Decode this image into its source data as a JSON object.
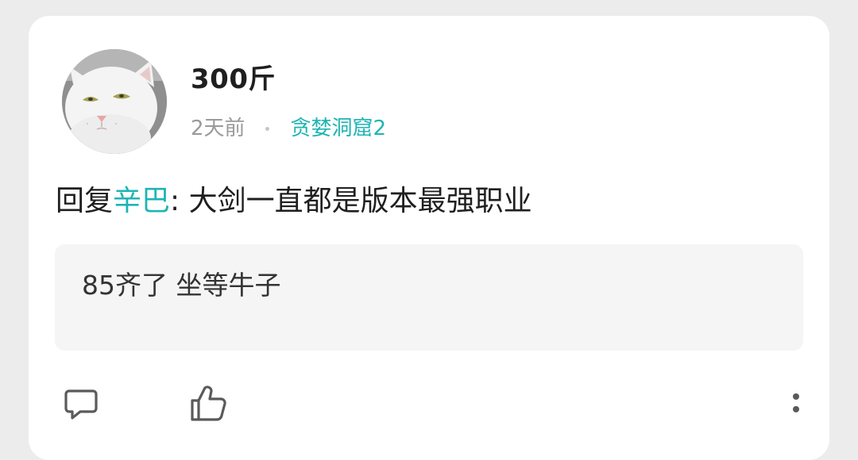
{
  "post": {
    "author": {
      "name": "300斤",
      "avatar_icon": "white-cat-avatar"
    },
    "time_ago": "2天前",
    "community": "贪婪洞窟2",
    "reply_prefix": "回复",
    "reply_target": "辛巴",
    "reply_separator": ": ",
    "content": "大剑一直都是版本最强职业",
    "quoted_text": "85齐了 坐等牛子"
  },
  "actions": {
    "comment_icon": "comment-icon",
    "like_icon": "thumbs-up-icon",
    "more_icon": "more-vertical-icon"
  },
  "colors": {
    "accent": "#1fb4b4",
    "text_primary": "#1f1f1f",
    "text_secondary": "#9a9a9a",
    "card_bg": "#ffffff",
    "page_bg": "#ececec",
    "quote_bg": "#f5f5f5",
    "icon": "#5a5a5a"
  }
}
